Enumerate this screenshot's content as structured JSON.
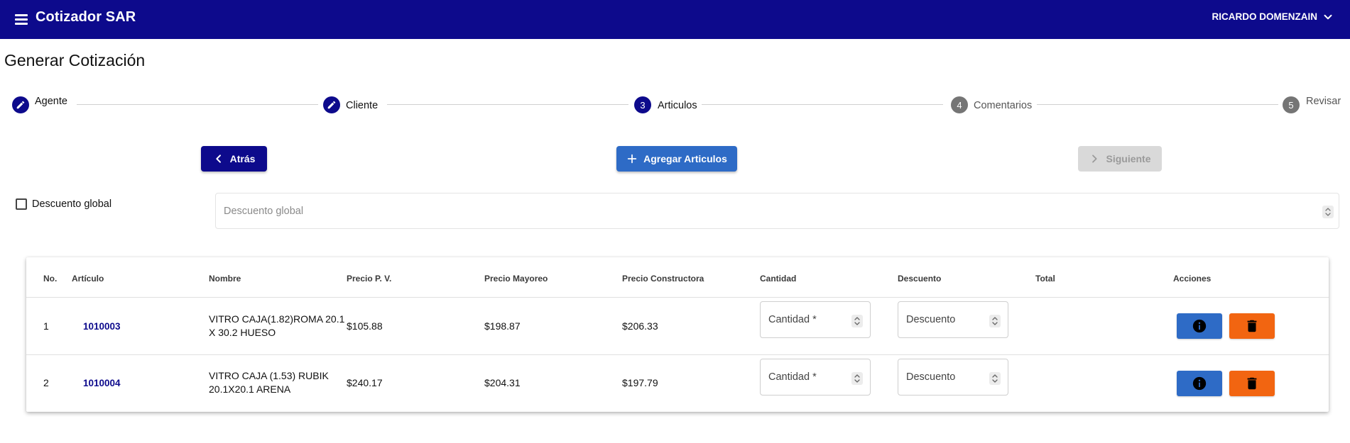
{
  "app": {
    "title": "Cotizador SAR",
    "user": "RICARDO DOMENZAIN",
    "header_color": "#0d0a8c"
  },
  "page": {
    "title": "Generar Cotización"
  },
  "stepper": {
    "steps": [
      {
        "number": "",
        "label": "Agente",
        "state": "completed",
        "icon": "pencil-icon"
      },
      {
        "number": "",
        "label": "Cliente",
        "state": "completed",
        "icon": "pencil-icon"
      },
      {
        "number": "3",
        "label": "Articulos",
        "state": "active"
      },
      {
        "number": "4",
        "label": "Comentarios",
        "state": "pending"
      },
      {
        "number": "5",
        "label": "Revisar",
        "state": "pending"
      }
    ]
  },
  "actions": {
    "back_label": "Atrás",
    "add_label": "Agregar Articulos",
    "next_label": "Siguiente",
    "next_disabled": true
  },
  "global_discount": {
    "checkbox_label": "Descuento global",
    "checked": false,
    "placeholder": "Descuento global",
    "value": ""
  },
  "table": {
    "columns": [
      "No.",
      "Artículo",
      "Nombre",
      "Precio P. V.",
      "Precio Mayoreo",
      "Precio Constructora",
      "Cantidad",
      "Descuento",
      "Total",
      "Acciones"
    ],
    "rows": [
      {
        "no": "1",
        "article": "1010003",
        "name": "VITRO CAJA(1.82)ROMA 20.1 X 30.2 HUESO",
        "price_pv": "$105.88",
        "price_mayoreo": "$198.87",
        "price_constructora": "$206.33",
        "quantity_placeholder": "Cantidad *",
        "discount_placeholder": "Descuento",
        "total": ""
      },
      {
        "no": "2",
        "article": "1010004",
        "name": "VITRO CAJA (1.53) RUBIK 20.1X20.1 ARENA",
        "price_pv": "$240.17",
        "price_mayoreo": "$204.31",
        "price_constructora": "$197.79",
        "quantity_placeholder": "Cantidad *",
        "discount_placeholder": "Descuento",
        "total": ""
      }
    ],
    "row_actions": {
      "info_icon": "info-icon",
      "delete_icon": "trash-icon",
      "info_color": "#2e6bc6",
      "delete_color": "#f26511"
    }
  }
}
